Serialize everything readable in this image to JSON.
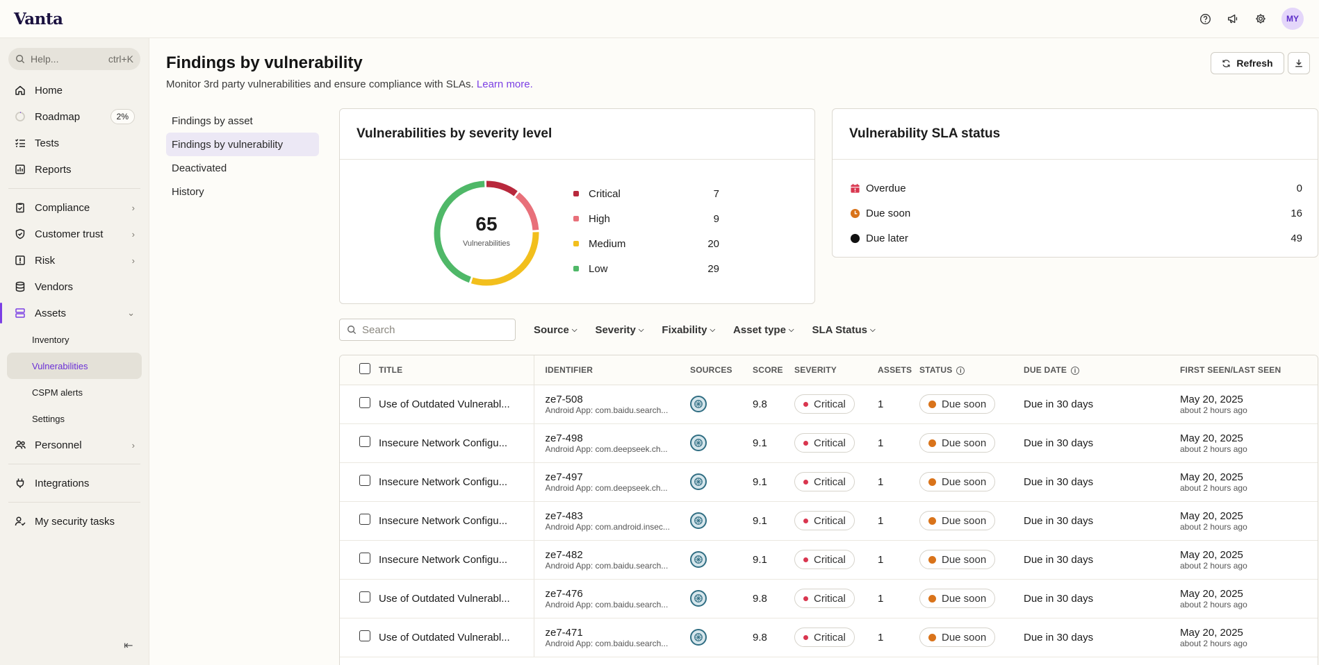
{
  "app": {
    "logo": "Vanta",
    "user_initials": "MY"
  },
  "sidebar": {
    "help_placeholder": "Help...",
    "help_shortcut": "ctrl+K",
    "roadmap_progress": "2%",
    "items": [
      {
        "label": "Home",
        "icon": "home-icon"
      },
      {
        "label": "Roadmap",
        "icon": "progress-ring-icon"
      },
      {
        "label": "Tests",
        "icon": "checklist-icon"
      },
      {
        "label": "Reports",
        "icon": "chart-icon"
      },
      {
        "label": "Compliance",
        "icon": "clipboard-icon"
      },
      {
        "label": "Customer trust",
        "icon": "shield-icon"
      },
      {
        "label": "Risk",
        "icon": "alert-box-icon"
      },
      {
        "label": "Vendors",
        "icon": "database-icon"
      },
      {
        "label": "Assets",
        "icon": "layers-icon"
      },
      {
        "label": "Personnel",
        "icon": "people-icon"
      },
      {
        "label": "Integrations",
        "icon": "plug-icon"
      },
      {
        "label": "My security tasks",
        "icon": "user-check-icon"
      }
    ],
    "asset_subitems": [
      "Inventory",
      "Vulnerabilities",
      "CSPM alerts",
      "Settings"
    ]
  },
  "page": {
    "title": "Findings by vulnerability",
    "subtitle": "Monitor 3rd party vulnerabilities and ensure compliance with SLAs.",
    "learn_more": "Learn more.",
    "refresh_label": "Refresh"
  },
  "subnav": [
    "Findings by asset",
    "Findings by vulnerability",
    "Deactivated",
    "History"
  ],
  "severity_card": {
    "title": "Vulnerabilities by severity level",
    "total": "65",
    "total_label": "Vulnerabilities",
    "levels": [
      {
        "label": "Critical",
        "value": 7,
        "color": "#b8283c"
      },
      {
        "label": "High",
        "value": 9,
        "color": "#e8707a"
      },
      {
        "label": "Medium",
        "value": 20,
        "color": "#f2bf1d"
      },
      {
        "label": "Low",
        "value": 29,
        "color": "#4fb868"
      }
    ]
  },
  "sla_card": {
    "title": "Vulnerability SLA status",
    "rows": [
      {
        "label": "Overdue",
        "value": "0",
        "icon": "calendar-alert-icon",
        "color": "#d9364f"
      },
      {
        "label": "Due soon",
        "value": "16",
        "icon": "clock-icon",
        "color": "#d9731a"
      },
      {
        "label": "Due later",
        "value": "49",
        "icon": "circle-icon",
        "color": "#111111"
      }
    ]
  },
  "filters": {
    "search_placeholder": "Search",
    "buttons": [
      "Source",
      "Severity",
      "Fixability",
      "Asset type",
      "SLA Status"
    ]
  },
  "table": {
    "headers": [
      "Title",
      "Identifier",
      "Sources",
      "Score",
      "Severity",
      "Assets",
      "Status",
      "Due date",
      "First seen/last seen"
    ],
    "rows": [
      {
        "title": "Use of Outdated Vulnerabl...",
        "id": "ze7-508",
        "id_sub": "Android App: com.baidu.search...",
        "score": "9.8",
        "severity": "Critical",
        "assets": "1",
        "status": "Due soon",
        "due": "Due in 30 days",
        "seen": "May 20, 2025",
        "seen_sub": "about 2 hours ago"
      },
      {
        "title": "Insecure Network Configu...",
        "id": "ze7-498",
        "id_sub": "Android App: com.deepseek.ch...",
        "score": "9.1",
        "severity": "Critical",
        "assets": "1",
        "status": "Due soon",
        "due": "Due in 30 days",
        "seen": "May 20, 2025",
        "seen_sub": "about 2 hours ago"
      },
      {
        "title": "Insecure Network Configu...",
        "id": "ze7-497",
        "id_sub": "Android App: com.deepseek.ch...",
        "score": "9.1",
        "severity": "Critical",
        "assets": "1",
        "status": "Due soon",
        "due": "Due in 30 days",
        "seen": "May 20, 2025",
        "seen_sub": "about 2 hours ago"
      },
      {
        "title": "Insecure Network Configu...",
        "id": "ze7-483",
        "id_sub": "Android App: com.android.insec...",
        "score": "9.1",
        "severity": "Critical",
        "assets": "1",
        "status": "Due soon",
        "due": "Due in 30 days",
        "seen": "May 20, 2025",
        "seen_sub": "about 2 hours ago"
      },
      {
        "title": "Insecure Network Configu...",
        "id": "ze7-482",
        "id_sub": "Android App: com.baidu.search...",
        "score": "9.1",
        "severity": "Critical",
        "assets": "1",
        "status": "Due soon",
        "due": "Due in 30 days",
        "seen": "May 20, 2025",
        "seen_sub": "about 2 hours ago"
      },
      {
        "title": "Use of Outdated Vulnerabl...",
        "id": "ze7-476",
        "id_sub": "Android App: com.baidu.search...",
        "score": "9.8",
        "severity": "Critical",
        "assets": "1",
        "status": "Due soon",
        "due": "Due in 30 days",
        "seen": "May 20, 2025",
        "seen_sub": "about 2 hours ago"
      },
      {
        "title": "Use of Outdated Vulnerabl...",
        "id": "ze7-471",
        "id_sub": "Android App: com.baidu.search...",
        "score": "9.8",
        "severity": "Critical",
        "assets": "1",
        "status": "Due soon",
        "due": "Due in 30 days",
        "seen": "May 20, 2025",
        "seen_sub": "about 2 hours ago"
      }
    ]
  }
}
